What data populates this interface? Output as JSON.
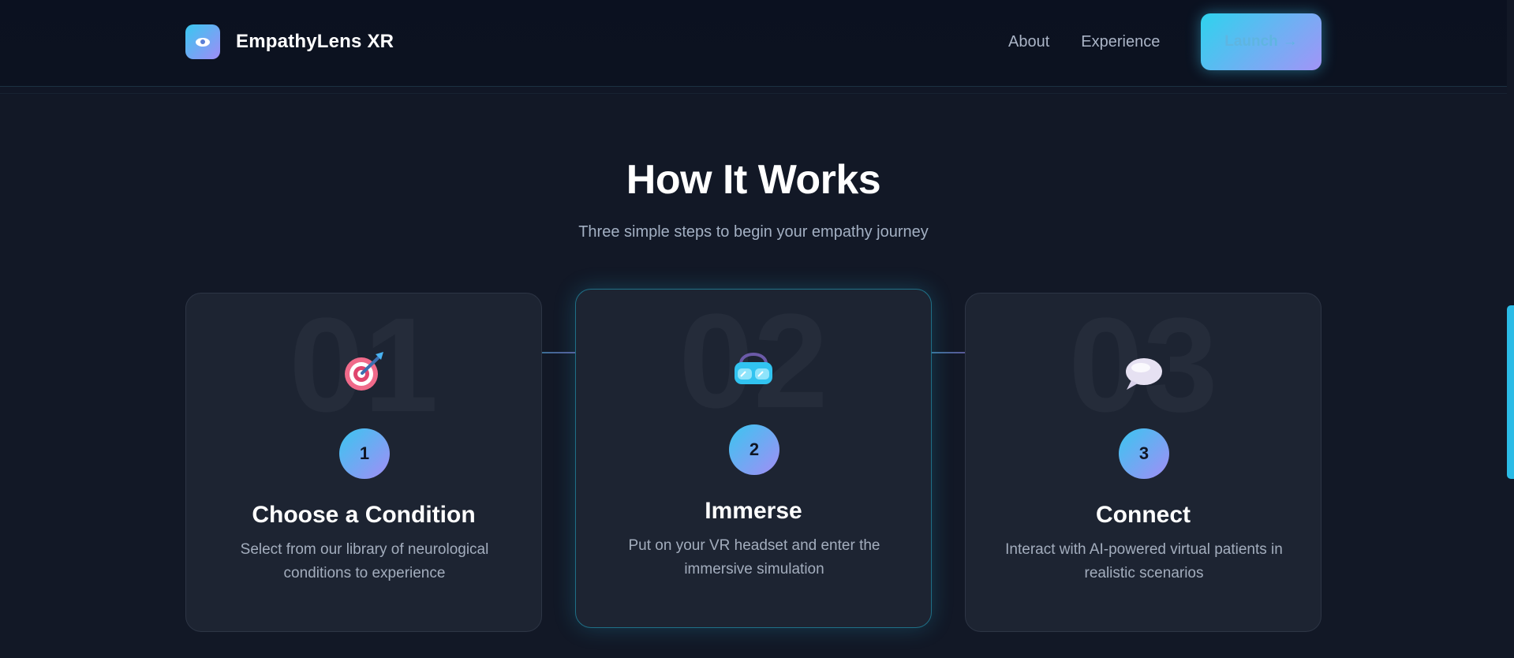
{
  "header": {
    "brand_name": "EmpathyLens XR",
    "nav": [
      {
        "label": "About"
      },
      {
        "label": "Experience"
      }
    ],
    "launch_label": "Launch",
    "launch_arrow": "→"
  },
  "section": {
    "title": "How It Works",
    "subtitle": "Three simple steps to begin your empathy journey"
  },
  "steps": [
    {
      "watermark": "01",
      "icon": "target-icon",
      "number": "1",
      "title": "Choose a Condition",
      "description": "Select from our library of neurological conditions to experience"
    },
    {
      "watermark": "02",
      "icon": "vr-goggles-icon",
      "number": "2",
      "title": "Immerse",
      "description": "Put on your VR headset and enter the immersive simulation"
    },
    {
      "watermark": "03",
      "icon": "speech-bubble-icon",
      "number": "3",
      "title": "Connect",
      "description": "Interact with AI-powered virtual patients in realistic scenarios"
    }
  ],
  "colors": {
    "background": "#121826",
    "accent_start": "#38c8f0",
    "accent_end": "#a28df5",
    "card": "#1d2432"
  }
}
